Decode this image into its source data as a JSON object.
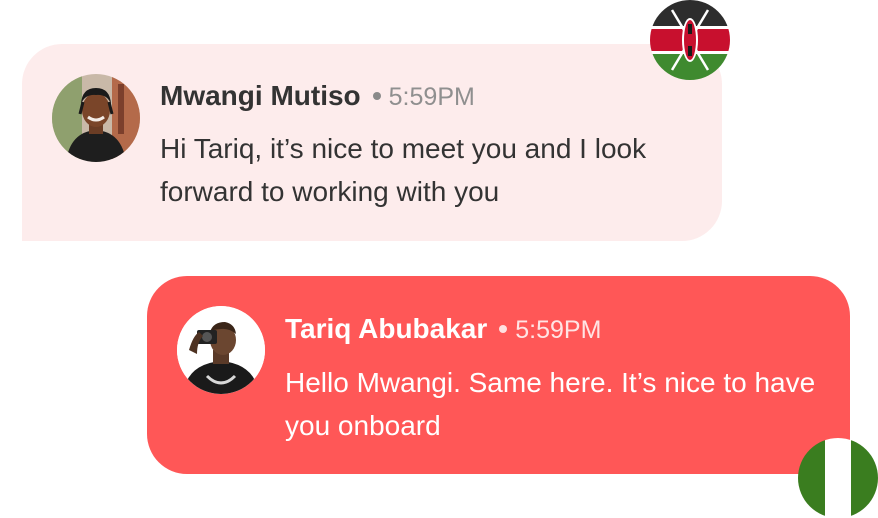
{
  "messages": [
    {
      "sender": "Mwangi Mutiso",
      "time": "5:59PM",
      "text": "Hi Tariq, it’s nice to meet you and  I look forward to working with you",
      "flag_icon": "kenya-flag-icon",
      "bubble_color": "#fdecec",
      "text_color": "#333333"
    },
    {
      "sender": "Tariq Abubakar",
      "time": "5:59PM",
      "text": "Hello Mwangi. Same here. It’s nice to have you onboard",
      "flag_icon": "nigeria-flag-icon",
      "bubble_color": "#ff5757",
      "text_color": "#ffffff"
    }
  ]
}
